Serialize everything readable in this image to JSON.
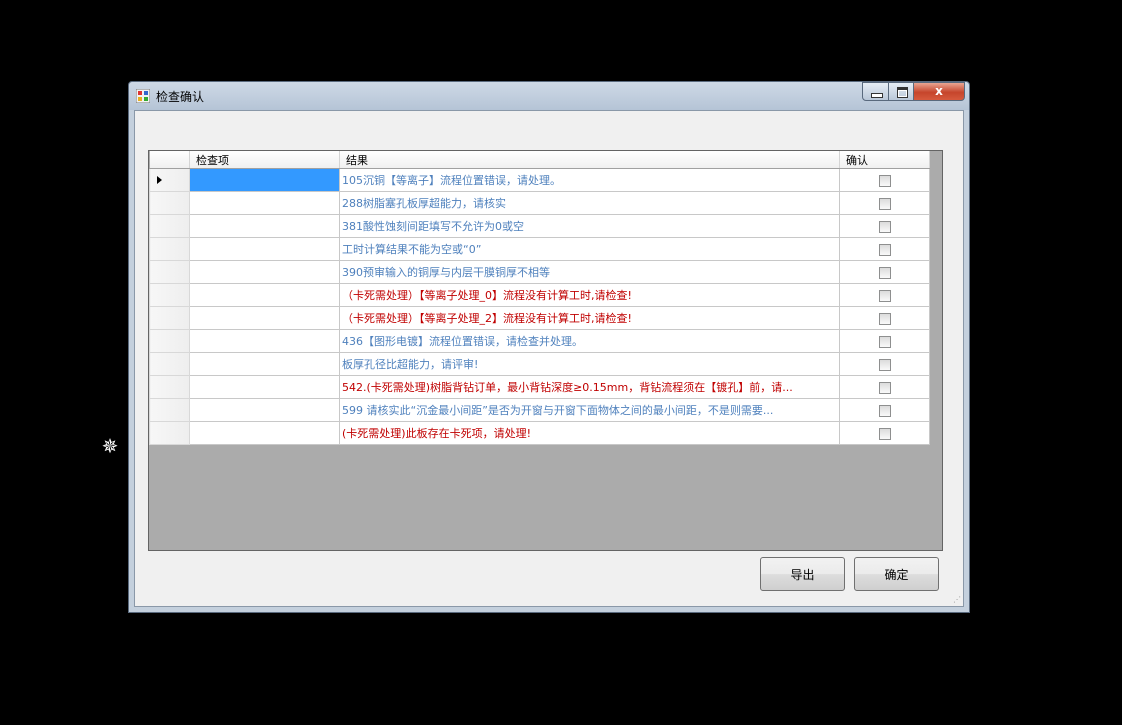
{
  "window": {
    "title": "检查确认",
    "close_glyph": "x"
  },
  "grid": {
    "columns": [
      "检查项",
      "结果",
      "确认"
    ],
    "rows": [
      {
        "item": "",
        "result": "105沉铜【等离子】流程位置错误，请处理。",
        "color": "#4f81bd",
        "checked": false,
        "selected": true
      },
      {
        "item": "",
        "result": "288树脂塞孔板厚超能力，请核实",
        "color": "#4f81bd",
        "checked": false
      },
      {
        "item": "",
        "result": "381酸性蚀刻间距填写不允许为0或空",
        "color": "#4f81bd",
        "checked": false
      },
      {
        "item": "",
        "result": "工时计算结果不能为空或“0”",
        "color": "#4f81bd",
        "checked": false
      },
      {
        "item": "",
        "result": "390预审输入的铜厚与内层干膜铜厚不相等",
        "color": "#4f81bd",
        "checked": false
      },
      {
        "item": "",
        "result": "（卡死需处理）【等离子处理_0】流程没有计算工时,请检查!",
        "color": "#c00000",
        "checked": false
      },
      {
        "item": "",
        "result": "（卡死需处理）【等离子处理_2】流程没有计算工时,请检查!",
        "color": "#c00000",
        "checked": false
      },
      {
        "item": "",
        "result": "436【图形电镀】流程位置错误，请检查并处理。",
        "color": "#4f81bd",
        "checked": false
      },
      {
        "item": "",
        "result": "板厚孔径比超能力，请评审!",
        "color": "#4f81bd",
        "checked": false
      },
      {
        "item": "",
        "result": "542.(卡死需处理)树脂背钻订单，最小背钻深度≥0.15mm，背钻流程须在【镀孔】前，请...",
        "color": "#c00000",
        "checked": false
      },
      {
        "item": "",
        "result": "599 请核实此“沉金最小间距”是否为开窗与开窗下面物体之间的最小间距，不是则需要...",
        "color": "#4f81bd",
        "checked": false
      },
      {
        "item": "",
        "result": "(卡死需处理)此板存在卡死项，请处理!",
        "color": "#c00000",
        "checked": false
      }
    ]
  },
  "buttons": {
    "export_label": "导出",
    "ok_label": "确定"
  },
  "icons": {
    "app": "app-window-icon",
    "cursor": "move-cursor-icon"
  }
}
